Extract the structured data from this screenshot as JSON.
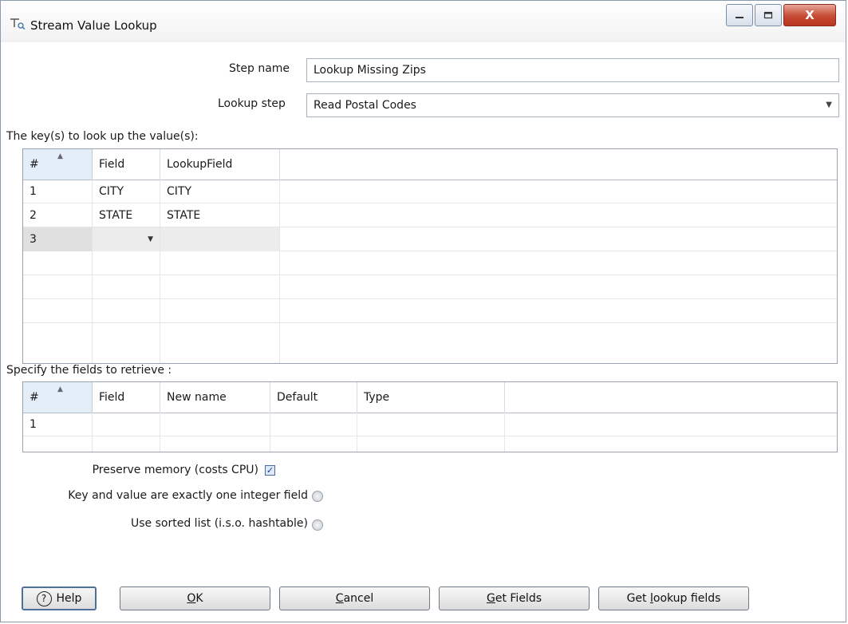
{
  "window": {
    "title": "Stream Value Lookup",
    "close_glyph": "X"
  },
  "form": {
    "step_name_label": "Step name",
    "step_name_value": "Lookup Missing Zips",
    "lookup_step_label": "Lookup step",
    "lookup_step_value": "Read Postal Codes"
  },
  "keys_section": {
    "title": "The key(s) to look up the value(s):",
    "columns": [
      "#",
      "Field",
      "LookupField"
    ],
    "rows": [
      {
        "num": "1",
        "field": "CITY",
        "lookup": "CITY"
      },
      {
        "num": "2",
        "field": "STATE",
        "lookup": "STATE"
      },
      {
        "num": "3",
        "field": "",
        "lookup": ""
      }
    ]
  },
  "retrieve_section": {
    "title": "Specify the fields to retrieve :",
    "columns": [
      "#",
      "Field",
      "New name",
      "Default",
      "Type"
    ],
    "rows": [
      {
        "num": "1",
        "field": "",
        "new_name": "",
        "default": "",
        "type": ""
      }
    ]
  },
  "options": {
    "preserve_memory_label": "Preserve memory (costs CPU)",
    "preserve_memory_checked": true,
    "integer_field_label": "Key and value are exactly one integer field",
    "sorted_list_label": "Use sorted list (i.s.o. hashtable)"
  },
  "buttons": {
    "help": "Help",
    "ok_u": "O",
    "ok_rest": "K",
    "cancel_u": "C",
    "cancel_rest": "ancel",
    "get_fields_u": "G",
    "get_fields_rest": "et Fields",
    "get_lookup_pre": "Get ",
    "get_lookup_u": "l",
    "get_lookup_rest": "ookup fields"
  },
  "icons": {
    "window_icon": "stream-lookup-icon",
    "help_icon": "question-circle-icon",
    "checkbox_mark": "✓",
    "dropdown": "▼"
  }
}
